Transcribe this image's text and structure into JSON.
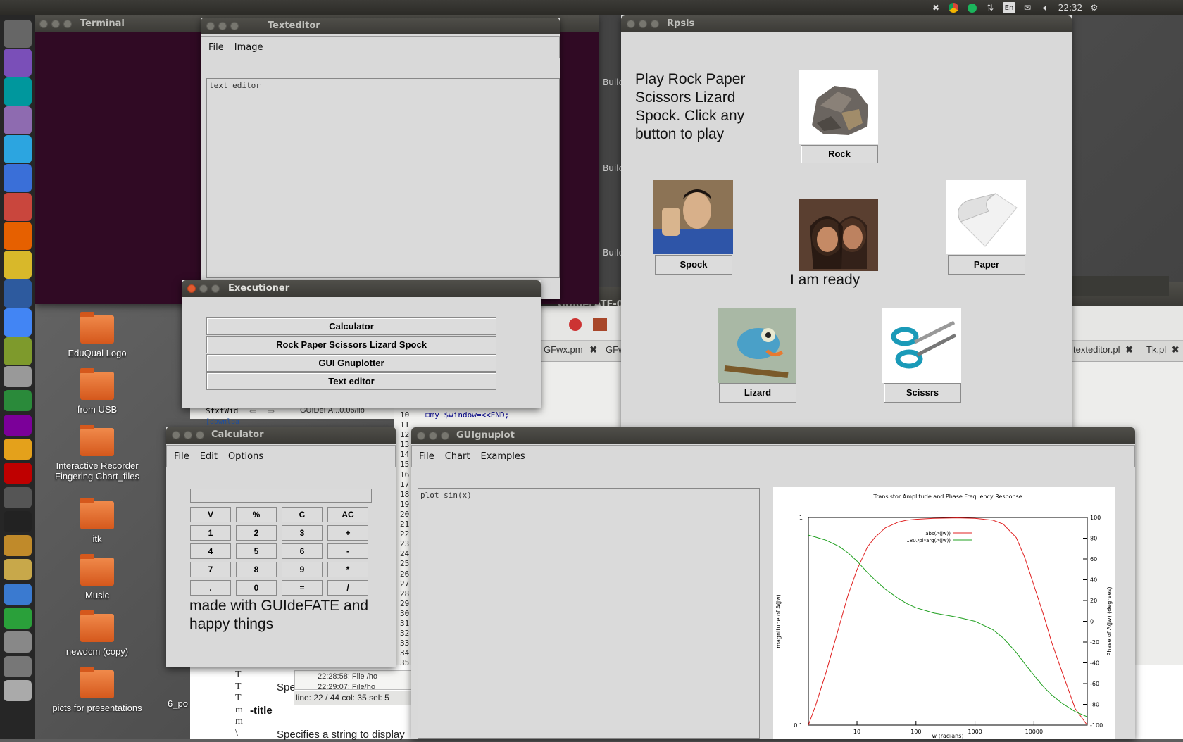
{
  "topbar": {
    "time": "22:32",
    "lang": "En"
  },
  "launcher": {
    "items": [
      "dash-icon",
      "viber-icon",
      "arduino-icon",
      "media-icon",
      "telegram-icon",
      "app-icon",
      "files-icon",
      "firefox-icon",
      "app2-icon",
      "varicad-icon",
      "chrome-icon",
      "app3-icon",
      "printer-icon",
      "app4-icon",
      "yahoo-icon",
      "app5-icon",
      "filezilla-icon",
      "books-icon",
      "amazon-icon",
      "app6-icon",
      "app7-icon",
      "app8-icon",
      "app9-icon",
      "app10-icon",
      "app11-icon",
      "trash-icon"
    ]
  },
  "desktop_icons": [
    "EduQual Logo",
    "from USB",
    "Interactive Recorder Fingering Chart_files",
    "itk",
    "Music",
    "newdcm (copy)",
    "picts for presentations"
  ],
  "desktop_extra": "6_po",
  "terminal": {
    "title": "Terminal"
  },
  "texteditor": {
    "title": "Texteditor",
    "menu": [
      "File",
      "Image"
    ],
    "content": "text editor"
  },
  "background_ide": {
    "title": "GUIdeFATE-0.0",
    "build_labels": [
      "Build",
      "Build",
      "Build"
    ],
    "tabs": [
      "GFwx.pm",
      "GFw",
      "texteditor.pl",
      "Tk.pl"
    ],
    "code_snippet": "$txtWid",
    "download": "[downloa",
    "folder_path": "GUIDeFA...0.06/lib",
    "line_numbers": [
      "10",
      "11",
      "12",
      "13",
      "14",
      "15",
      "16",
      "17",
      "18",
      "19",
      "20",
      "21",
      "22",
      "23",
      "24",
      "25",
      "26",
      "27",
      "28",
      "29",
      "30",
      "31",
      "32",
      "33",
      "34",
      "35"
    ],
    "code_line": "my $window=<<END;",
    "log1": "22:28:58: File /ho",
    "log2": "22:29:07: File/ho",
    "status": "line: 22 / 44   col: 35   sel: 5",
    "doc_lines": [
      "T",
      "T",
      "T",
      "m",
      "m",
      "\\"
    ],
    "doc_spe": "Spe",
    "doc_title": "-title",
    "doc_specifies": "Specifies a string to display"
  },
  "rpsls": {
    "title": "Rpsls",
    "prompt": "Play Rock Paper Scissors Lizard Spock.  Click any button to play",
    "status": "I am ready",
    "buttons": {
      "rock": "Rock",
      "spock": "Spock",
      "paper": "Paper",
      "lizard": "Lizard",
      "scissors": "Scissrs"
    }
  },
  "executioner": {
    "title": "Executioner",
    "buttons": [
      "Calculator",
      "Rock Paper Scissors Lizard Spock",
      "GUI Gnuplotter",
      "Text editor"
    ]
  },
  "calculator": {
    "title": "Calculator",
    "menu": [
      "File",
      "Edit",
      "Options"
    ],
    "display": "",
    "keys": [
      [
        "V",
        "%",
        "C",
        "AC"
      ],
      [
        "1",
        "2",
        "3",
        "+"
      ],
      [
        "4",
        "5",
        "6",
        "-"
      ],
      [
        "7",
        "8",
        "9",
        "*"
      ],
      [
        ".",
        "0",
        "=",
        "/"
      ]
    ],
    "footer": "made with GUIdeFATE and happy things"
  },
  "gnuplot": {
    "title": "GUIgnuplot",
    "menu": [
      "File",
      "Chart",
      "Examples"
    ],
    "script": "plot sin(x)"
  },
  "chart_data": {
    "type": "line",
    "title": "Transistor Amplitude and Phase Frequency Response",
    "xlabel": "w (radians)",
    "ylabel": "magnitude of A(jw)",
    "y2label": "Phase of A(jw) (degrees)",
    "xscale": "log",
    "yscale": "log",
    "xlim": [
      1.5,
      80000
    ],
    "ylim": [
      0.1,
      1
    ],
    "y2lim": [
      -100,
      100
    ],
    "x_ticks": [
      "10",
      "100",
      "1000",
      "10000"
    ],
    "y_ticks": [
      "0.1",
      "1"
    ],
    "y2_ticks": [
      "100",
      "80",
      "60",
      "40",
      "20",
      "0",
      "-20",
      "-40",
      "-60",
      "-80",
      "-100"
    ],
    "legend_position": "top-center",
    "series": [
      {
        "name": "abs(A(jw))",
        "color": "#e02020",
        "axis": "y",
        "x": [
          1.5,
          2,
          3,
          5,
          7,
          10,
          15,
          20,
          30,
          50,
          70,
          100,
          200,
          500,
          1000,
          2000,
          3000,
          5000,
          7000,
          10000,
          15000,
          20000,
          30000,
          50000,
          80000
        ],
        "values": [
          0.1,
          0.125,
          0.18,
          0.3,
          0.42,
          0.56,
          0.72,
          0.8,
          0.89,
          0.95,
          0.97,
          0.98,
          0.99,
          0.995,
          0.99,
          0.97,
          0.93,
          0.8,
          0.64,
          0.47,
          0.33,
          0.25,
          0.18,
          0.12,
          0.095
        ]
      },
      {
        "name": "180./pi*arg(A(jw))",
        "color": "#20a020",
        "axis": "y2",
        "x": [
          1.5,
          2,
          3,
          5,
          7,
          10,
          15,
          20,
          30,
          50,
          70,
          100,
          200,
          500,
          1000,
          2000,
          3000,
          5000,
          7000,
          10000,
          15000,
          20000,
          30000,
          50000,
          80000
        ],
        "values": [
          83,
          81,
          78,
          72,
          66,
          58,
          47,
          40,
          31,
          22,
          17,
          13,
          8,
          4,
          0,
          -8,
          -16,
          -30,
          -41,
          -52,
          -64,
          -71,
          -79,
          -87,
          -92
        ]
      }
    ]
  }
}
